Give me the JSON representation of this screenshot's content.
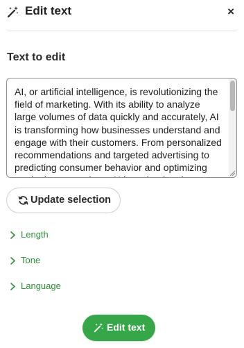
{
  "header": {
    "title": "Edit text",
    "icon": "magic-wand-icon",
    "close_label": "×"
  },
  "main": {
    "section_title": "Text to edit",
    "text_value": "AI, or artificial intelligence, is revolutionizing the field of marketing. With its ability to analyze large volumes of data quickly and accurately, AI is transforming how businesses understand and engage with their customers. From personalized recommendations and targeted advertising to predicting consumer behavior and optimizing marketing campaigns, AI is reshaping the way businesses connect with their audience.",
    "update_label": "Update selection",
    "update_icon": "refresh-icon"
  },
  "options": [
    {
      "label": "Length",
      "icon": "chevron-right-icon"
    },
    {
      "label": "Tone",
      "icon": "chevron-right-icon"
    },
    {
      "label": "Language",
      "icon": "chevron-right-icon"
    }
  ],
  "footer": {
    "edit_label": "Edit text",
    "icon": "magic-wand-icon"
  },
  "colors": {
    "accent": "#36a748",
    "link": "#2f8f3a",
    "text": "#1f1f1f",
    "border": "#8e8e8e"
  }
}
